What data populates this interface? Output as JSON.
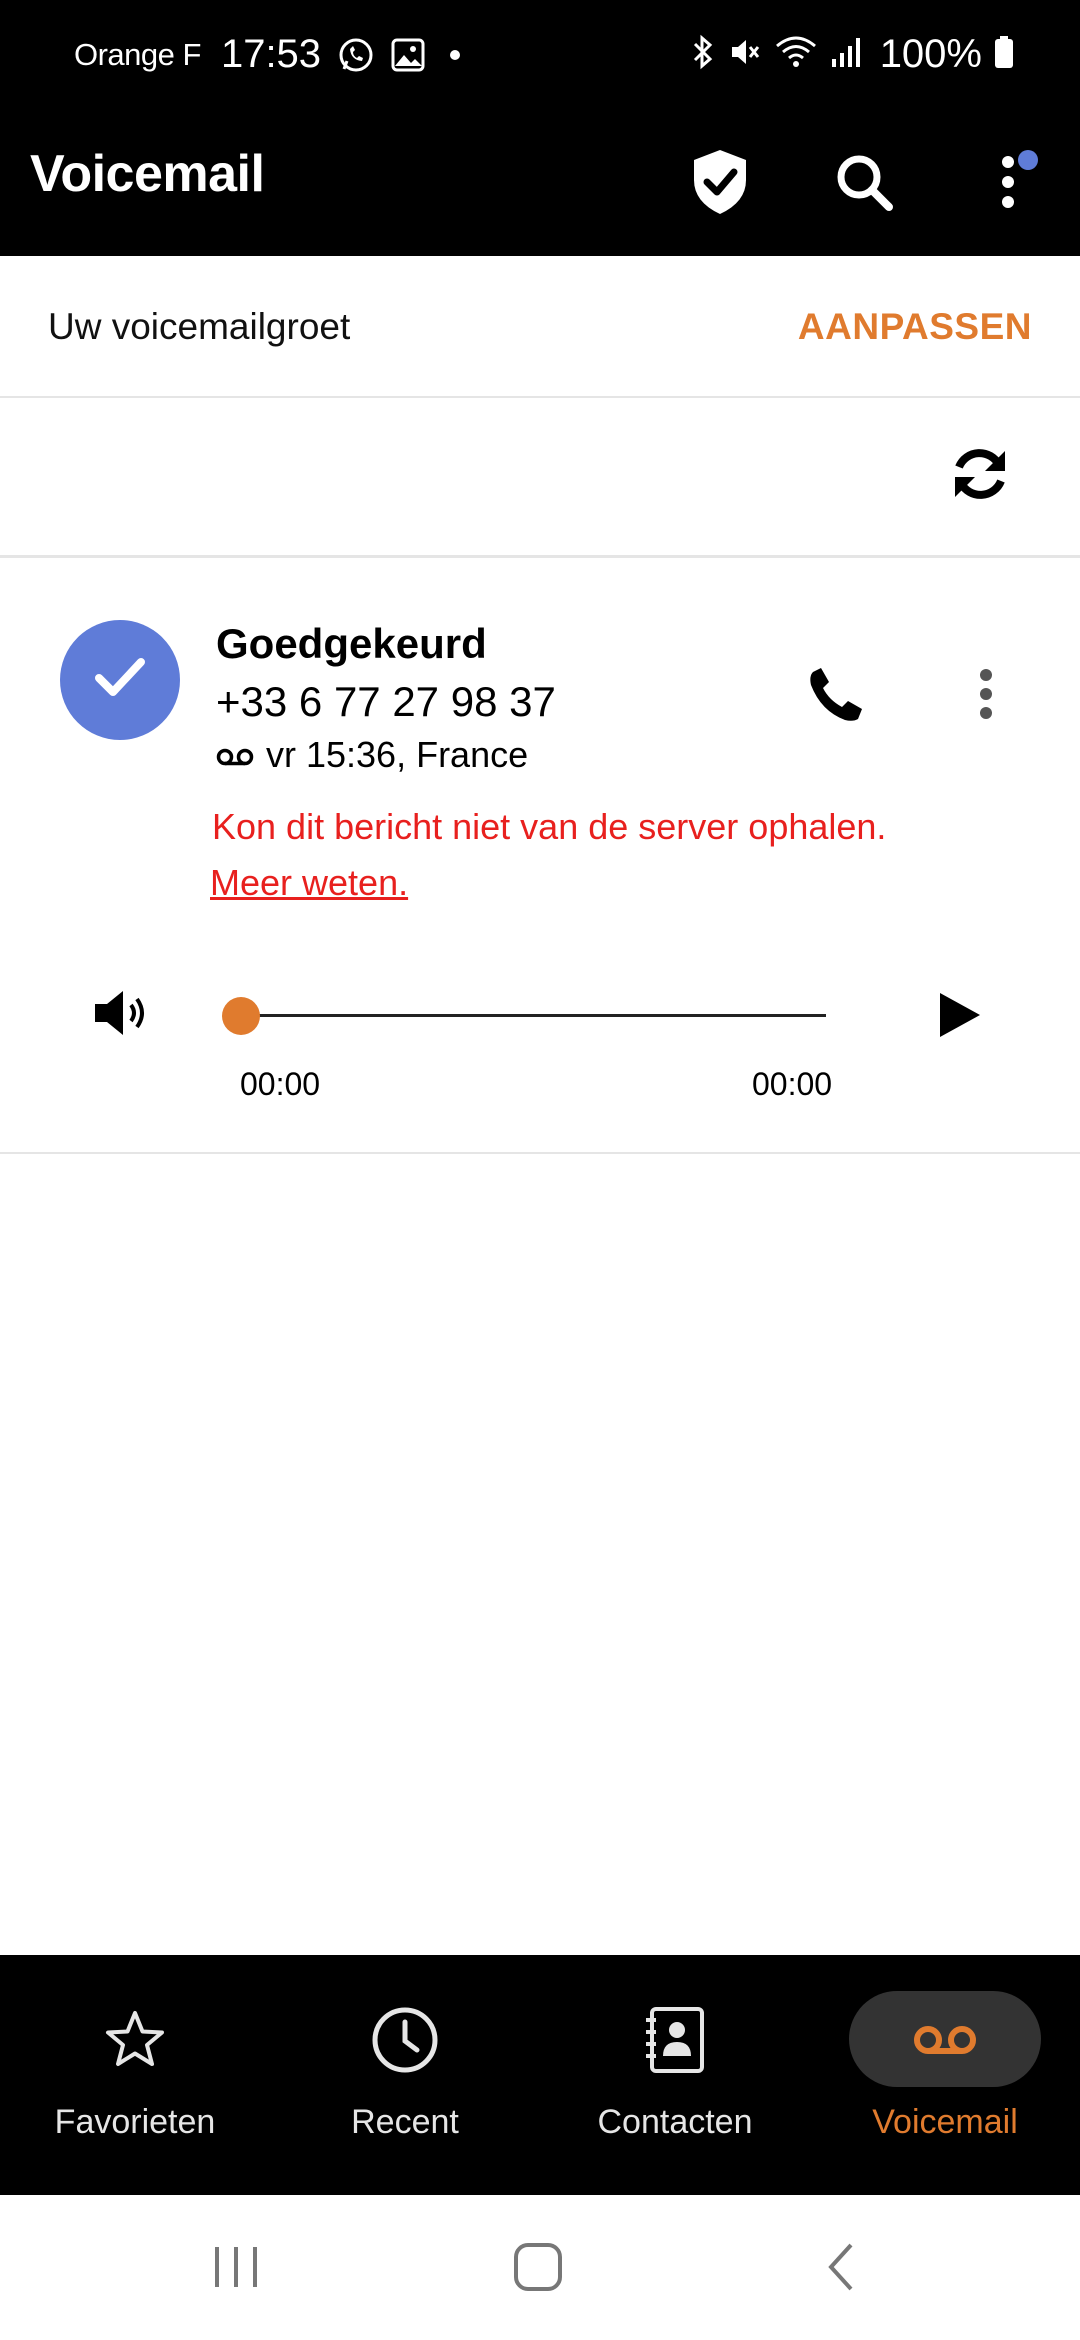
{
  "status_bar": {
    "carrier": "Orange F",
    "time": "17:53",
    "battery_text": "100%",
    "icons": [
      "whatsapp-icon",
      "gallery-icon",
      "notification-dot-icon",
      "bluetooth-icon",
      "mute-icon",
      "wifi-icon",
      "signal-icon",
      "battery-icon"
    ]
  },
  "app_bar": {
    "title": "Voicemail",
    "icons": [
      "shield-check-icon",
      "search-icon",
      "more-vert-icon"
    ],
    "colors": {
      "badge": "#5f7cd8"
    }
  },
  "greeting": {
    "label": "Uw voicemailgroet",
    "action": "AANPASSEN"
  },
  "voicemail": {
    "name": "Goedgekeurd",
    "number": "+33 6 77 27 98 37",
    "meta": "vr 15:36, France",
    "error": "Kon dit bericht niet van de server ophalen.",
    "link": "Meer weten.",
    "player": {
      "time_start": "00:00",
      "time_end": "00:00",
      "progress": 0
    }
  },
  "bottom_nav": {
    "items": [
      {
        "label": "Favorieten",
        "icon": "star-icon",
        "active": false
      },
      {
        "label": "Recent",
        "icon": "clock-icon",
        "active": false
      },
      {
        "label": "Contacten",
        "icon": "contacts-icon",
        "active": false
      },
      {
        "label": "Voicemail",
        "icon": "voicemail-icon",
        "active": true
      }
    ]
  },
  "colors": {
    "accent": "#e07b2e",
    "avatar": "#5f7cd8",
    "error": "#e8201e"
  }
}
